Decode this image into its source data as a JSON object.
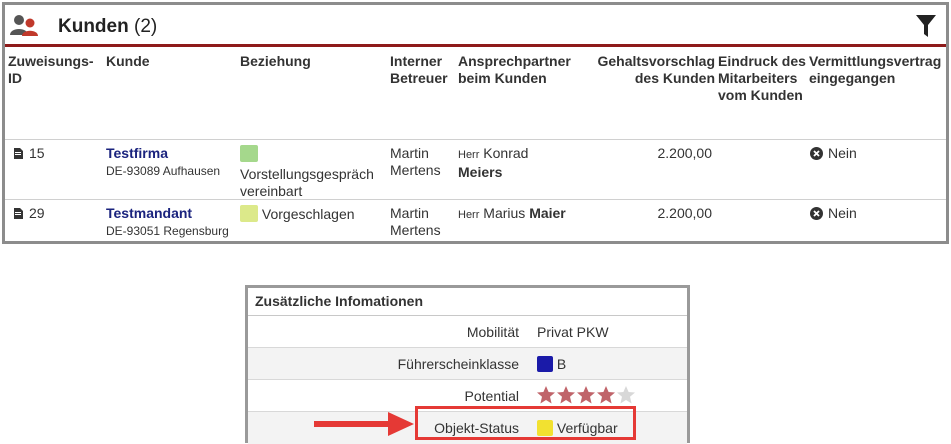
{
  "panel": {
    "title": "Kunden",
    "count": "(2)",
    "icons": {
      "header": "users-icon",
      "filter": "filter-icon"
    }
  },
  "columns": [
    "Zuweisungs-ID",
    "Kunde",
    "Beziehung",
    "Interner Betreuer",
    "Ansprechpartner beim Kunden",
    "Gehaltsvorschlag des Kunden",
    "Eindruck des Mitarbeiters vom Kunden",
    "Vermittlungsvertrag eingegangen"
  ],
  "rows": [
    {
      "id": "15",
      "customer": "Testfirma",
      "address": "DE-93089 Aufhausen",
      "relation": "Vorstellungsgespräch vereinbart",
      "relation_color": "#a5d88c",
      "supervisor": "Martin Mertens",
      "contact_salutation": "Herr",
      "contact_first": "Konrad",
      "contact_last": "Meiers",
      "salary": "2.200,00",
      "impression": "",
      "contract": "Nein"
    },
    {
      "id": "29",
      "customer": "Testmandant",
      "address": "DE-93051 Regensburg",
      "relation": "Vorgeschlagen",
      "relation_color": "#dce98a",
      "supervisor": "Martin Mertens",
      "contact_salutation": "Herr",
      "contact_first": "Marius",
      "contact_last": "Maier",
      "salary": "2.200,00",
      "impression": "",
      "contract": "Nein"
    }
  ],
  "info": {
    "title": "Zusätzliche Infomationen",
    "rows": [
      {
        "label": "Mobilität",
        "value": "Privat PKW"
      },
      {
        "label": "Führerscheinklasse",
        "value": "B",
        "color": "#1a1aa8"
      },
      {
        "label": "Potential",
        "stars_filled": 4,
        "stars_total": 5
      },
      {
        "label": "Objekt-Status",
        "value": "Verfügbar",
        "color": "#f2e130"
      }
    ]
  },
  "accent_colors": {
    "header_rule": "#8e1a1a",
    "highlight": "#e53935",
    "link": "#1a237e"
  }
}
